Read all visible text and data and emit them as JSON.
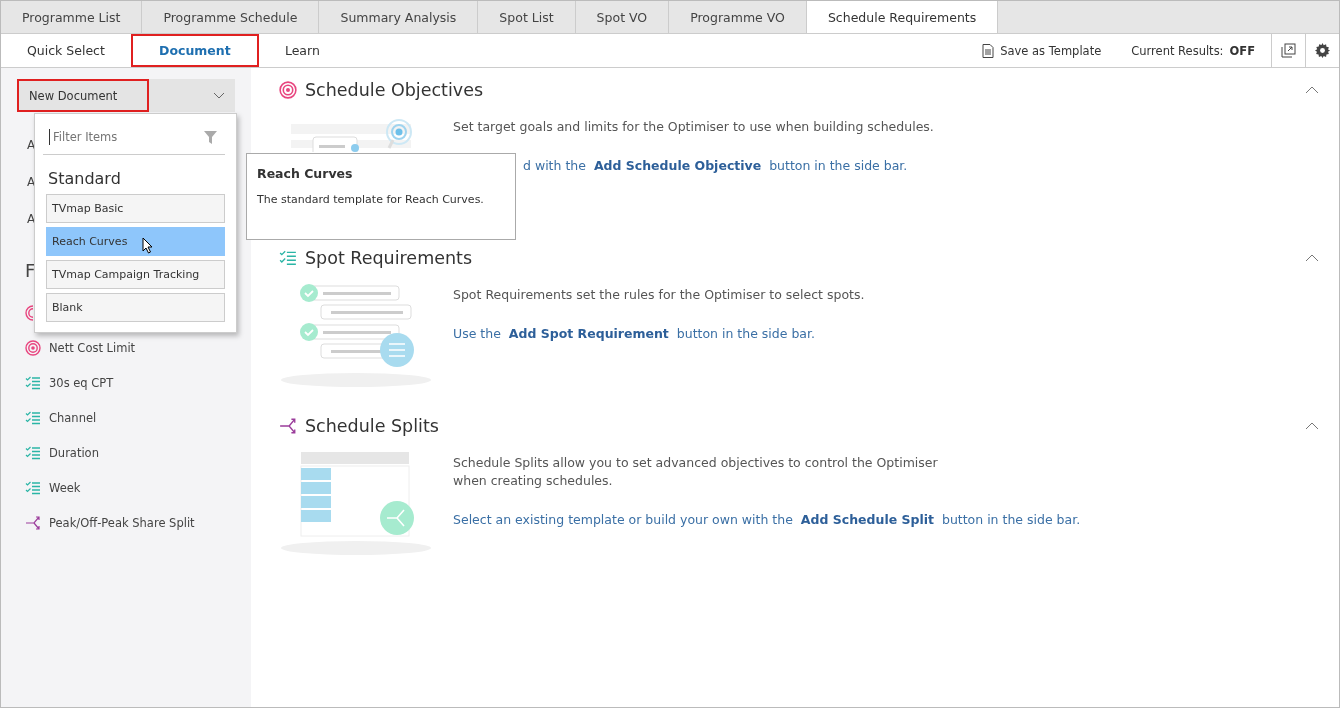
{
  "top_tabs": [
    {
      "label": "Programme List",
      "selected": false
    },
    {
      "label": "Programme Schedule",
      "selected": false
    },
    {
      "label": "Summary Analysis",
      "selected": false
    },
    {
      "label": "Spot List",
      "selected": false
    },
    {
      "label": "Spot VO",
      "selected": false
    },
    {
      "label": "Programme VO",
      "selected": false
    },
    {
      "label": "Schedule Requirements",
      "selected": true
    }
  ],
  "sub_tabs": [
    {
      "label": "Quick Select",
      "selected": false,
      "highlighted": false
    },
    {
      "label": "Document",
      "selected": true,
      "highlighted": true
    },
    {
      "label": "Learn",
      "selected": false,
      "highlighted": false
    }
  ],
  "toolbar": {
    "save_template": "Save as Template",
    "results_label": "Current Results:",
    "results_value": "OFF"
  },
  "sidebar": {
    "document_select": {
      "value": "New Document",
      "highlighted": true
    },
    "items": [
      {
        "kind": "text",
        "label": "A"
      },
      {
        "kind": "text",
        "label": "A"
      },
      {
        "kind": "text",
        "label": "A"
      },
      {
        "kind": "heading",
        "label": "F"
      },
      {
        "kind": "target"
      },
      {
        "kind": "target",
        "label": "Nett Cost Limit"
      },
      {
        "kind": "checklist",
        "label": "30s eq CPT"
      },
      {
        "kind": "checklist",
        "label": "Channel"
      },
      {
        "kind": "checklist",
        "label": "Duration"
      },
      {
        "kind": "checklist",
        "label": "Week"
      },
      {
        "kind": "split",
        "label": "Peak/Off-Peak Share Split"
      }
    ]
  },
  "dropdown": {
    "placeholder": "Filter Items",
    "group": "Standard",
    "options": [
      {
        "label": "TVmap Basic",
        "selected": false
      },
      {
        "label": "Reach Curves",
        "selected": true
      },
      {
        "label": "TVmap Campaign Tracking",
        "selected": false
      },
      {
        "label": "Blank",
        "selected": false
      }
    ]
  },
  "tooltip": {
    "title": "Reach Curves",
    "text": "The standard template for Reach Curves."
  },
  "sections": [
    {
      "kind": "target",
      "title": "Schedule Objectives",
      "description": "Set target goals and limits for the Optimiser to use when building schedules.",
      "link": "d with the  **Add Schedule Objective**  button in the side bar.",
      "covered": true
    },
    {
      "kind": "checklist",
      "title": "Spot Requirements",
      "description": "Spot Requirements set the rules for the Optimiser to select spots.",
      "link": "Use the  **Add Spot Requirement**  button in the side bar.",
      "covered": false
    },
    {
      "kind": "split",
      "title": "Schedule Splits",
      "description": "Schedule Splits allow you to set advanced objectives to control the Optimiser\nwhen creating schedules.",
      "link": "Select an existing template or build your own with the  **Add Schedule Split**  button in the side bar.",
      "covered": false
    }
  ]
}
